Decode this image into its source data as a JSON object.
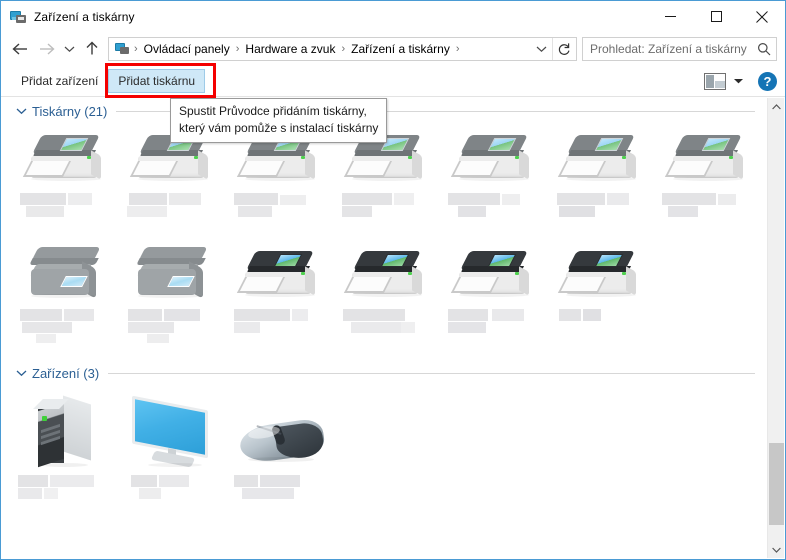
{
  "window": {
    "title": "Zařízení a tiskárny",
    "title_icon": "devices-printers-icon",
    "minimize_label": "minimize-icon",
    "maximize_label": "maximize-icon",
    "close_label": "close-icon",
    "accent_border": "#4a9bd4"
  },
  "navigation": {
    "back_label": "back-arrow-icon",
    "forward_label": "forward-arrow-icon",
    "recent_label": "recent-locations-chevron-icon",
    "up_label": "up-arrow-icon",
    "breadcrumbs": [
      {
        "label": "Ovládací panely"
      },
      {
        "label": "Hardware a zvuk"
      },
      {
        "label": "Zařízení a tiskárny"
      }
    ],
    "separator": "›",
    "dropdown_label": "address-dropdown-icon",
    "refresh_label": "refresh-icon"
  },
  "search": {
    "placeholder": "Prohledat: Zařízení a tiskárny",
    "value": "",
    "icon": "search-icon"
  },
  "toolbar": {
    "add_device_label": "Přidat zařízení",
    "add_printer_label": "Přidat tiskárnu",
    "preview_pane_label": "preview-pane-icon",
    "preview_dropdown_label": "chevron-down-icon",
    "help_label": "?"
  },
  "tooltip": {
    "line1": "Spustit Průvodce přidáním tiskárny,",
    "line2": "který vám pomůže s instalací tiskárny"
  },
  "annotation": {
    "color": "#f40000",
    "target": "Přidat tiskárnu"
  },
  "groups": [
    {
      "name": "printers-group",
      "header": "Tiskárny (21)",
      "header_visible_fragment": "y 1)",
      "expanded": true,
      "rows": [
        {
          "tiles": [
            {
              "icon": "printer-laser-light-icon",
              "label": ""
            },
            {
              "icon": "printer-laser-light-icon",
              "label": ""
            },
            {
              "icon": "printer-laser-light-icon",
              "label": ""
            },
            {
              "icon": "printer-laser-light-icon",
              "label": ""
            },
            {
              "icon": "printer-laser-light-icon",
              "label": ""
            },
            {
              "icon": "printer-laser-light-icon",
              "label": ""
            },
            {
              "icon": "printer-laser-light-icon",
              "label": ""
            }
          ]
        },
        {
          "tiles": [
            {
              "icon": "printer-multifunction-icon",
              "label": ""
            },
            {
              "icon": "printer-multifunction-icon",
              "label": ""
            },
            {
              "icon": "printer-laser-dark-icon",
              "label": ""
            },
            {
              "icon": "printer-laser-dark-icon",
              "label": ""
            },
            {
              "icon": "printer-laser-dark-icon",
              "label": ""
            },
            {
              "icon": "printer-laser-dark-icon",
              "label": ""
            }
          ]
        }
      ]
    },
    {
      "name": "devices-group",
      "header": "Zařízení (3)",
      "expanded": true,
      "rows": [
        {
          "tiles": [
            {
              "icon": "desktop-computer-icon",
              "label": ""
            },
            {
              "icon": "monitor-icon",
              "label": ""
            },
            {
              "icon": "mouse-icon",
              "label": ""
            }
          ]
        }
      ]
    }
  ],
  "scrollbar": {
    "up_label": "scroll-up-icon",
    "down_label": "scroll-down-icon",
    "thumb_label": "scroll-thumb"
  }
}
